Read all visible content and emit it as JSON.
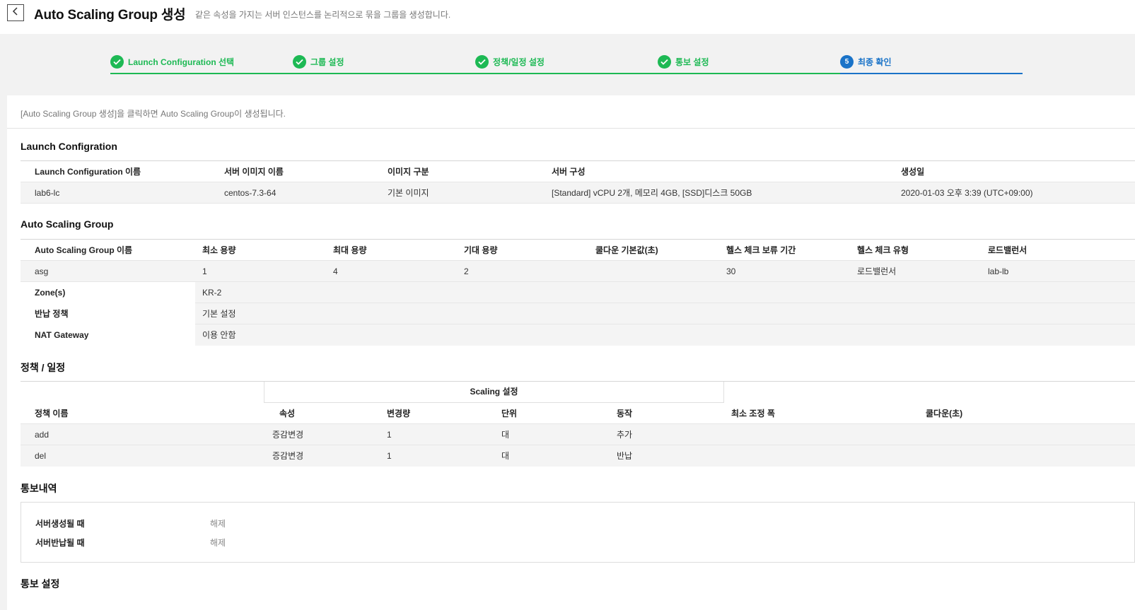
{
  "header": {
    "title": "Auto Scaling Group 생성",
    "description": "같은 속성을 가지는 서버 인스턴스를 논리적으로 묶을 그룹을 생성합니다."
  },
  "steps": [
    {
      "label": "Launch Configuration 선택",
      "status": "done"
    },
    {
      "label": "그룹 설정",
      "status": "done"
    },
    {
      "label": "정책/일정 설정",
      "status": "done"
    },
    {
      "label": "통보 설정",
      "status": "done"
    },
    {
      "label": "최종 확인",
      "status": "current",
      "number": "5"
    }
  ],
  "colors": {
    "done": "#1db954",
    "current": "#1a73c8"
  },
  "notice": "[Auto Scaling Group 생성]을 클릭하면 Auto Scaling Group이 생성됩니다.",
  "launch_config": {
    "title": "Launch Configration",
    "headers": [
      "Launch Configuration 이름",
      "서버 이미지 이름",
      "이미지 구분",
      "서버 구성",
      "생성일"
    ],
    "row": [
      "lab6-lc",
      "centos-7.3-64",
      "기본 이미지",
      "[Standard] vCPU 2개, 메모리 4GB, [SSD]디스크 50GB",
      "2020-01-03 오후 3:39 (UTC+09:00)"
    ]
  },
  "asg": {
    "title": "Auto Scaling Group",
    "headers": [
      "Auto Scaling Group 이름",
      "최소 용량",
      "최대 용량",
      "기대 용량",
      "쿨다운 기본값(초)",
      "헬스 체크 보류 기간",
      "헬스 체크 유형",
      "로드밸런서"
    ],
    "row": [
      "asg",
      "1",
      "4",
      "2",
      "",
      "30",
      "로드밸런서",
      "lab-lb"
    ],
    "extra": [
      {
        "label": "Zone(s)",
        "value": "KR-2"
      },
      {
        "label": "반납 정책",
        "value": "기본 설정"
      },
      {
        "label": "NAT Gateway",
        "value": "이용 안함"
      }
    ]
  },
  "policy": {
    "title": "정책 / 일정",
    "group_header": "Scaling 설정",
    "headers": [
      "정책 이름",
      "속성",
      "변경량",
      "단위",
      "동작",
      "최소 조정 폭",
      "쿨다운(초)"
    ],
    "rows": [
      [
        "add",
        "증감변경",
        "1",
        "대",
        "추가",
        "",
        ""
      ],
      [
        "del",
        "증감변경",
        "1",
        "대",
        "반납",
        "",
        ""
      ]
    ]
  },
  "notifications": {
    "title": "통보내역",
    "items": [
      {
        "label": "서버생성될 때",
        "value": "해제"
      },
      {
        "label": "서버반납될 때",
        "value": "해제"
      }
    ]
  },
  "notify_settings": {
    "title": "통보 설정"
  }
}
